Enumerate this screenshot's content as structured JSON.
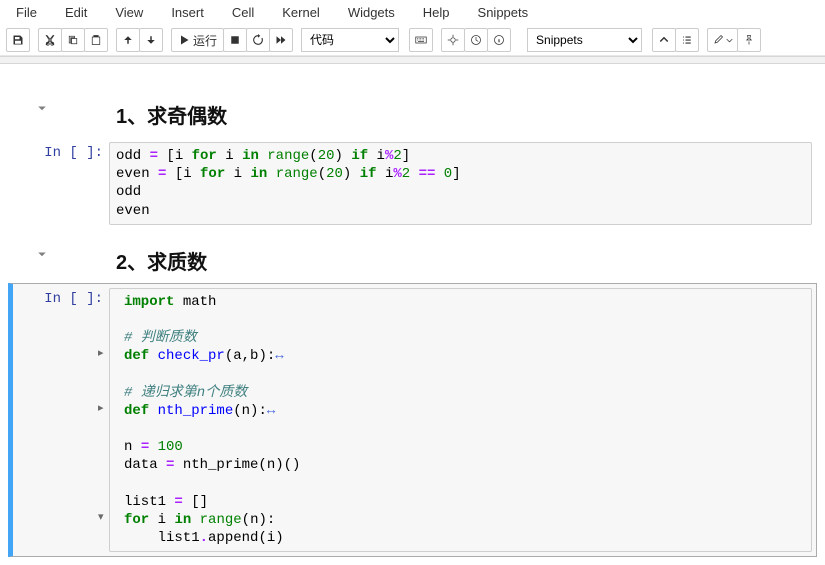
{
  "menu": {
    "file": "File",
    "edit": "Edit",
    "view": "View",
    "insert": "Insert",
    "cell": "Cell",
    "kernel": "Kernel",
    "widgets": "Widgets",
    "help": "Help",
    "snippets": "Snippets"
  },
  "toolbar": {
    "run_label": "运行",
    "cell_type": "代码",
    "snippets_label": "Snippets"
  },
  "cells": {
    "h1": {
      "text": "1、求奇偶数"
    },
    "c1": {
      "prompt": "In [ ]:",
      "l1a": "odd ",
      "l1b": " [i ",
      "l1c": "for",
      "l1d": " i ",
      "l1e": "in",
      "l1f": " ",
      "l1g": "range",
      "l1h": "(",
      "l1i": "20",
      "l1j": ") ",
      "l1k": "if",
      "l1l": " i",
      "l1m": "%",
      "l1n": "2",
      "l1o": "]",
      "l2a": "even ",
      "l2b": " [i ",
      "l2c": "for",
      "l2d": " i ",
      "l2e": "in",
      "l2f": " ",
      "l2g": "range",
      "l2h": "(",
      "l2i": "20",
      "l2j": ") ",
      "l2k": "if",
      "l2l": " i",
      "l2m": "%",
      "l2n": "2",
      "l2o": " ",
      "l2p": "==",
      "l2q": " ",
      "l2r": "0",
      "l2s": "]",
      "l3": "odd",
      "l4": "even",
      "eq": "="
    },
    "h2": {
      "text": "2、求质数"
    },
    "c2": {
      "prompt": "In [ ]:",
      "l1a": "import",
      "l1b": " math",
      "l2": "# 判断质数",
      "l3a": "def",
      "l3b": " ",
      "l3c": "check_pr",
      "l3d": "(a,b):",
      "l3e": "↔",
      "l4": "# 递归求第n个质数",
      "l5a": "def",
      "l5b": " ",
      "l5c": "nth_prime",
      "l5d": "(n):",
      "l5e": "↔",
      "l6a": "n ",
      "l6b": "=",
      "l6c": " ",
      "l6d": "100",
      "l7a": "data ",
      "l7b": "=",
      "l7c": " nth_prime(n)()",
      "l8a": "list1 ",
      "l8b": "=",
      "l8c": " []",
      "l9a": "for",
      "l9b": " i ",
      "l9c": "in",
      "l9d": " ",
      "l9e": "range",
      "l9f": "(n):",
      "l10a": "    list1",
      "l10b": ".",
      "l10c": "append(i)",
      "blank": " "
    }
  }
}
